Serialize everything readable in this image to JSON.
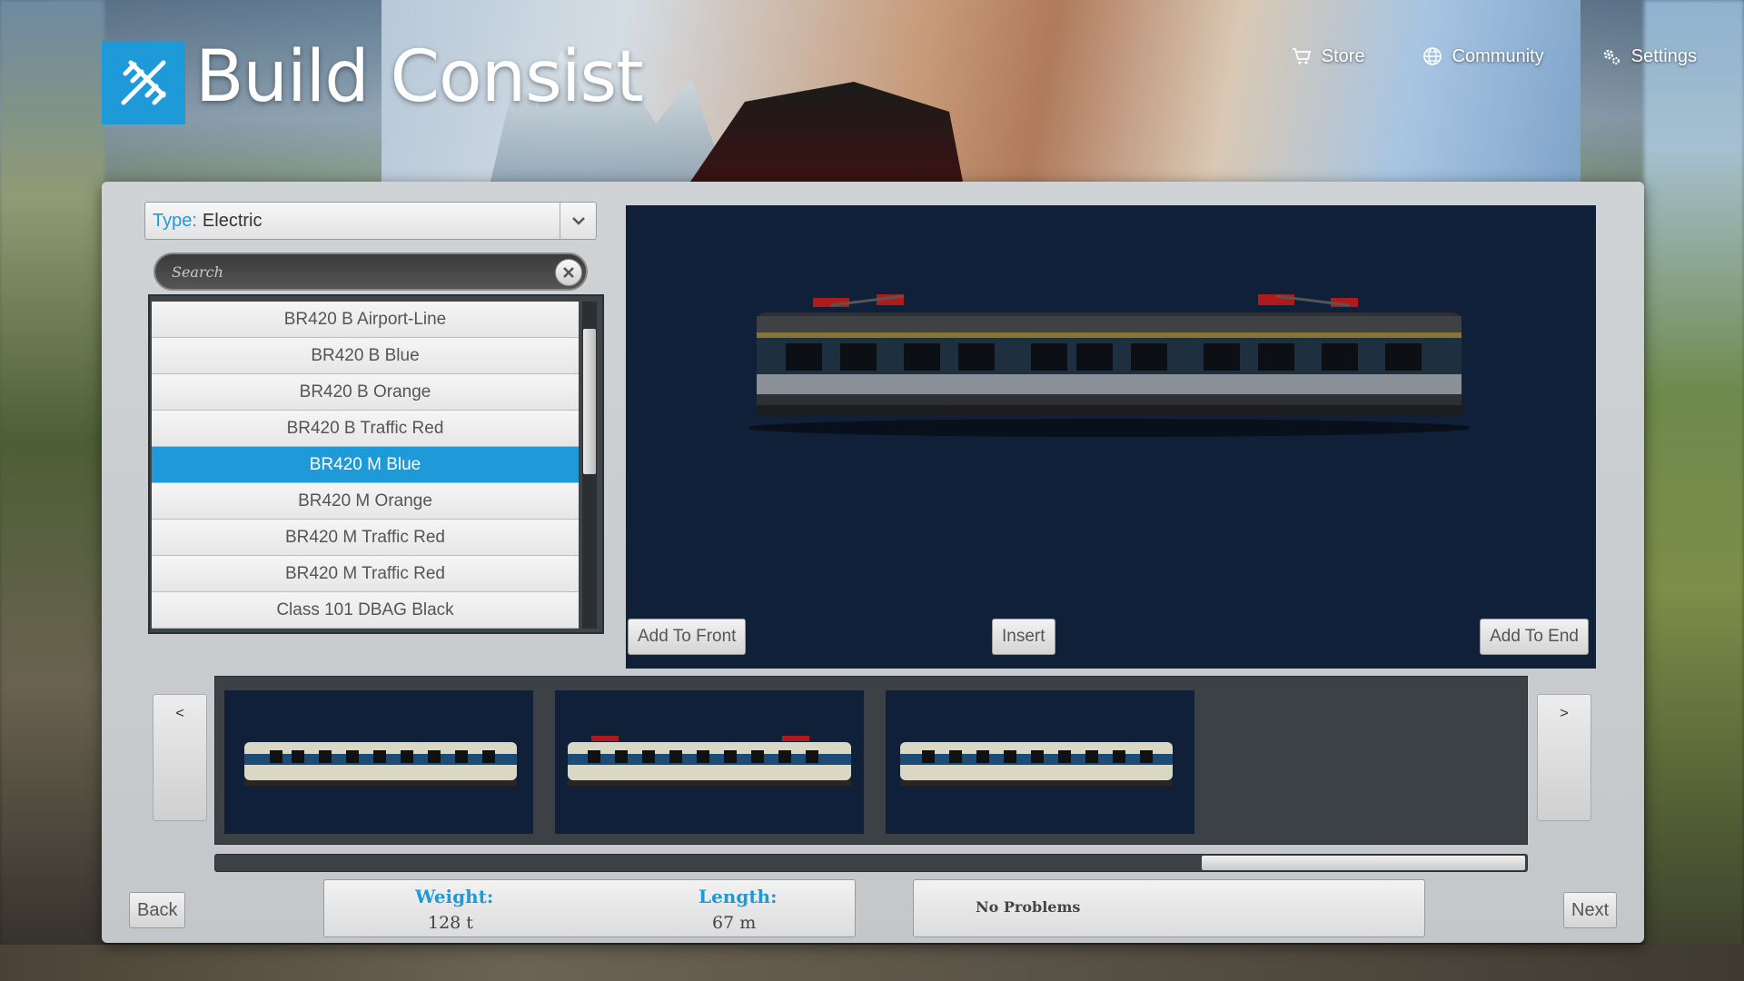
{
  "app": {
    "title": "Build Consist",
    "nav": [
      {
        "label": "Store",
        "icon": "cart-icon"
      },
      {
        "label": "Community",
        "icon": "globe-icon"
      },
      {
        "label": "Settings",
        "icon": "gear-icon"
      }
    ]
  },
  "filter": {
    "type_key": "Type:",
    "type_value": "Electric",
    "search_placeholder": "Search"
  },
  "vehicle_list": {
    "items": [
      "BR420 B Airport-Line",
      "BR420 B Blue",
      "BR420 B Orange",
      "BR420 B Traffic Red",
      "BR420 M Blue",
      "BR420 M Orange",
      "BR420 M Traffic Red",
      "BR420 M Traffic Red",
      "Class 101 DBAG Black"
    ],
    "selected_index": 4
  },
  "preview": {
    "add_front_label": "Add To Front",
    "insert_label": "Insert",
    "add_end_label": "Add To End"
  },
  "consist": {
    "prev_label": "<",
    "next_label": ">",
    "vehicles": [
      "BR420 B Blue",
      "BR420 M Blue",
      "BR420 B Blue"
    ]
  },
  "footer": {
    "back_label": "Back",
    "next_label": "Next",
    "weight_key": "Weight:",
    "weight_value": "128 t",
    "length_key": "Length:",
    "length_value": "67 m",
    "problems_text": "No Problems"
  },
  "colors": {
    "accent": "#1e9ad8",
    "preview_bg": "#102038",
    "panel_bg": "#c9ccd0"
  }
}
